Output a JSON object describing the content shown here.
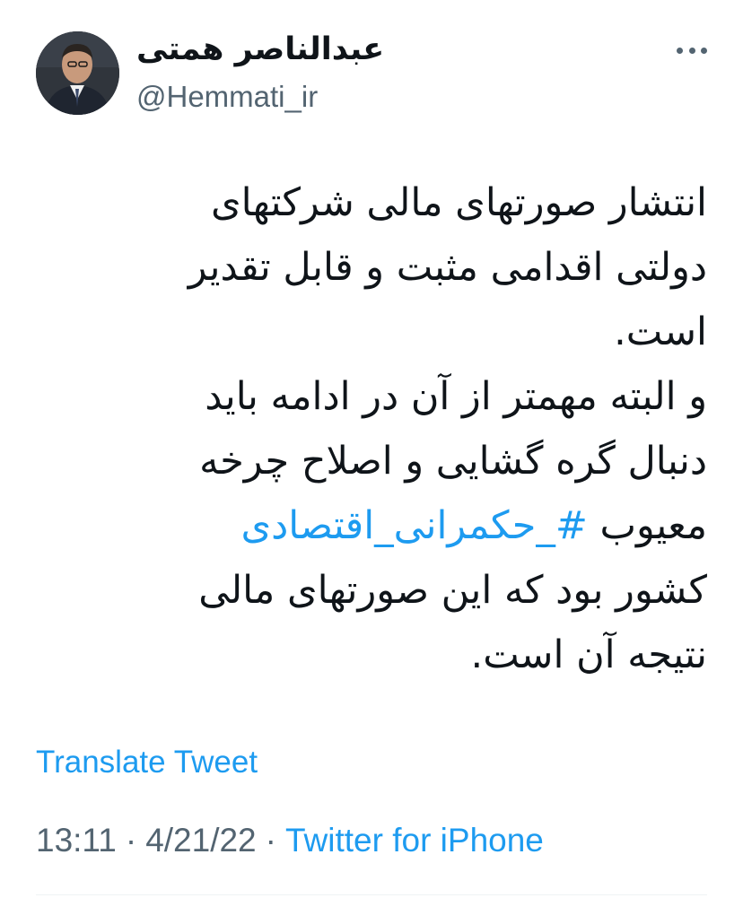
{
  "author": {
    "display_name": "عبدالناصر همتی",
    "handle": "@Hemmati_ir",
    "avatar_icon": "person-avatar-icon"
  },
  "more_icon": "more-horizontal-icon",
  "tweet": {
    "lines": [
      {
        "pre": "انتشار صورتهای مالی شرکتهای",
        "tag": "",
        "post": ""
      },
      {
        "pre": "دولتی اقدامی مثبت و قابل تقدیر",
        "tag": "",
        "post": ""
      },
      {
        "pre": "است.",
        "tag": "",
        "post": ""
      },
      {
        "pre": "و البته مهمتر از آن در ادامه باید",
        "tag": "",
        "post": ""
      },
      {
        "pre": "دنبال گره گشایی و اصلاح چرخه",
        "tag": "",
        "post": ""
      },
      {
        "pre": "معیوب ",
        "tag": "#_حکمرانی_اقتصادی",
        "post": ""
      },
      {
        "pre": "کشور بود که این صورتهای مالی",
        "tag": "",
        "post": ""
      },
      {
        "pre": "نتیجه آن است.",
        "tag": "",
        "post": ""
      }
    ]
  },
  "translate_label": "Translate Tweet",
  "meta": {
    "time": "13:11",
    "separator": "·",
    "date": "4/21/22",
    "source": "Twitter for iPhone"
  },
  "colors": {
    "link": "#1d9bf0",
    "secondary": "#536471",
    "text": "#0f1419"
  }
}
